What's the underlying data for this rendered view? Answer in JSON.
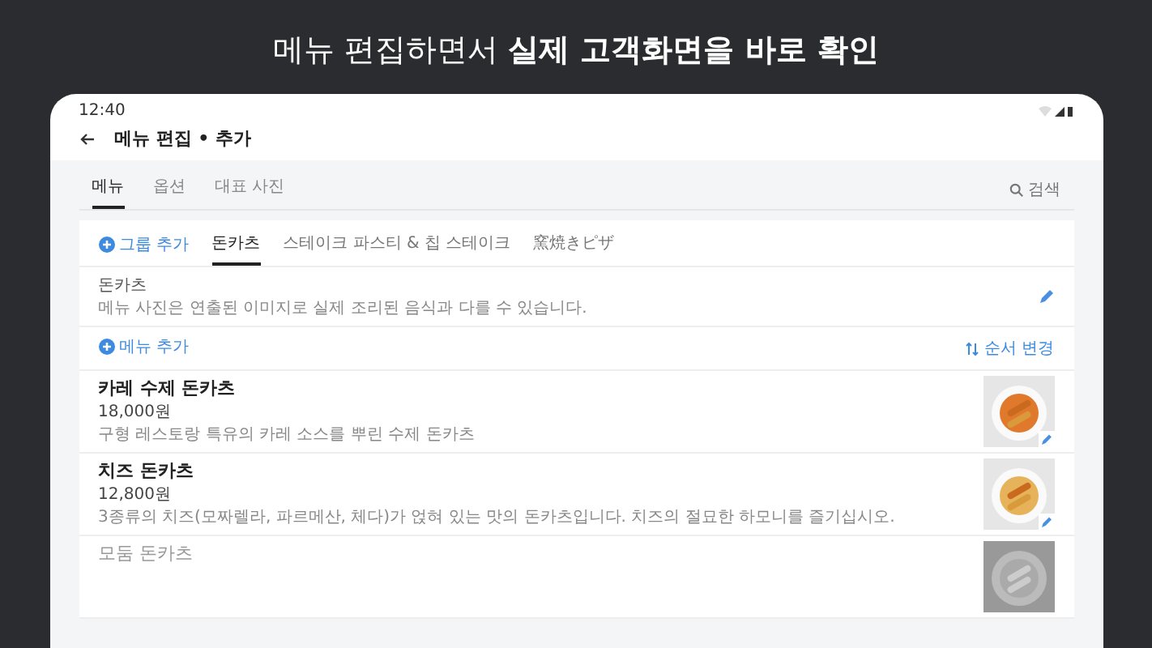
{
  "headline": "메뉴 편집하면서 **실제 고객화면을 바로 확인**",
  "status_bar": {
    "time": "12:40"
  },
  "app_bar": {
    "title": "메뉴 편집 • 추가"
  },
  "tabs": [
    {
      "label": "메뉴",
      "selected": true
    },
    {
      "label": "옵션",
      "selected": false
    },
    {
      "label": "대표 사진",
      "selected": false
    }
  ],
  "search": {
    "label": "검색"
  },
  "group_add": "그룹 추가",
  "groups": [
    {
      "label": "돈카츠",
      "selected": true
    },
    {
      "label": "스테이크 파스티 & 칩 스테이크",
      "selected": false
    },
    {
      "label": "窯焼きピザ",
      "selected": false
    }
  ],
  "section": {
    "title": "돈카츠",
    "note": "메뉴 사진은 연출된 이미지로 실제 조리된 음식과 다를 수 있습니다."
  },
  "menu_add": "메뉴 추가",
  "reorder": "순서 변경",
  "items": [
    {
      "name": "카레 수제 돈카츠",
      "price": "18,000원",
      "description": "구형 레스토랑 특유의 카레 소스를 뿌린 수제 돈카츠",
      "disabled": false,
      "kind": "picture"
    },
    {
      "name": "치즈 돈카츠",
      "price": "12,800원",
      "description": "3종류의 치즈(모짜렐라, 파르메산, 체다)가 얹혀 있는 맛의 돈카츠입니다. 치즈의 절묘한 하모니를 즐기십시오.",
      "disabled": false,
      "kind": "picture"
    },
    {
      "name": "모둠 돈카츠",
      "disabled": true,
      "kind": "picture"
    }
  ]
}
